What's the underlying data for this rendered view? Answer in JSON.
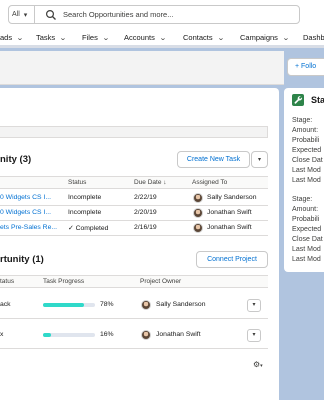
{
  "search": {
    "scope": "All",
    "placeholder": "Search Opportunities and more..."
  },
  "nav": {
    "items": [
      "ads",
      "Tasks",
      "Files",
      "Accounts",
      "Contacts",
      "Campaigns",
      "Dashb"
    ]
  },
  "header": {
    "follow_label": "+ Follo"
  },
  "tasks_card": {
    "title": "nity (3)",
    "new_task_label": "Create New Task",
    "columns": [
      "Status",
      "Due Date ↓",
      "Assigned To"
    ],
    "rows": [
      {
        "name": "0 Widgets CS I...",
        "status": "Incomplete",
        "due": "2/22/19",
        "assignee": "Sally Sanderson"
      },
      {
        "name": "0 Widgets CS I...",
        "status": "Incomplete",
        "due": "2/20/19",
        "assignee": "Jonathan Swift"
      },
      {
        "name": "ets Pre-Sales Re...",
        "status": "✓ Completed",
        "due": "2/16/19",
        "assignee": "Jonathan Swift"
      }
    ]
  },
  "project_card": {
    "title": "rtunity (1)",
    "connect_label": "Connect Project",
    "columns": [
      "tatus",
      "Task Progress",
      "Project Owner"
    ],
    "rows": [
      {
        "name": "ack",
        "progress": 78,
        "progress_label": "78%",
        "owner": "Sally Sanderson"
      },
      {
        "name": "x",
        "progress": 16,
        "progress_label": "16%",
        "owner": "Jonathan Swift"
      }
    ]
  },
  "right_panel": {
    "title": "Sta",
    "group1": [
      "Stage:",
      "Amount:",
      "Probabili",
      "Expected",
      "Close Dat",
      "Last Mod",
      "Last Mod"
    ],
    "group2": [
      "Stage:",
      "Amount:",
      "Probabili",
      "Expected",
      "Close Dat",
      "Last Mod",
      "Last Mod"
    ]
  },
  "colors": {
    "accent": "#0070d2",
    "progress": "#2fd9c9",
    "panel_icon": "#2e844a",
    "background": "#b0c4df"
  }
}
